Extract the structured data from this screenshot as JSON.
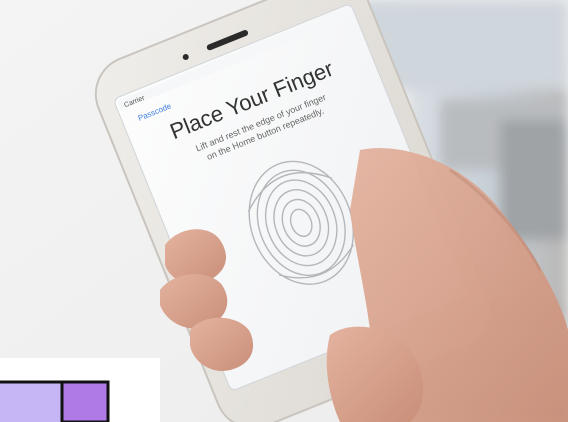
{
  "photo": {
    "status_bar": "Carrier",
    "back_label": "Passcode",
    "screen_title": "Place Your Finger",
    "instruction_line1": "Lift and rest the edge of your finger",
    "instruction_line2": "on the Home button repeatedly.",
    "fingerprint_icon": "fingerprint-icon",
    "colors": {
      "background": "#f3f3f3",
      "phone_body": "#e9e6e1",
      "screen": "#fbfbfb",
      "skin": "#d7a38f",
      "swatch_left": "#c7b6f5",
      "swatch_right": "#b07ae6"
    }
  }
}
